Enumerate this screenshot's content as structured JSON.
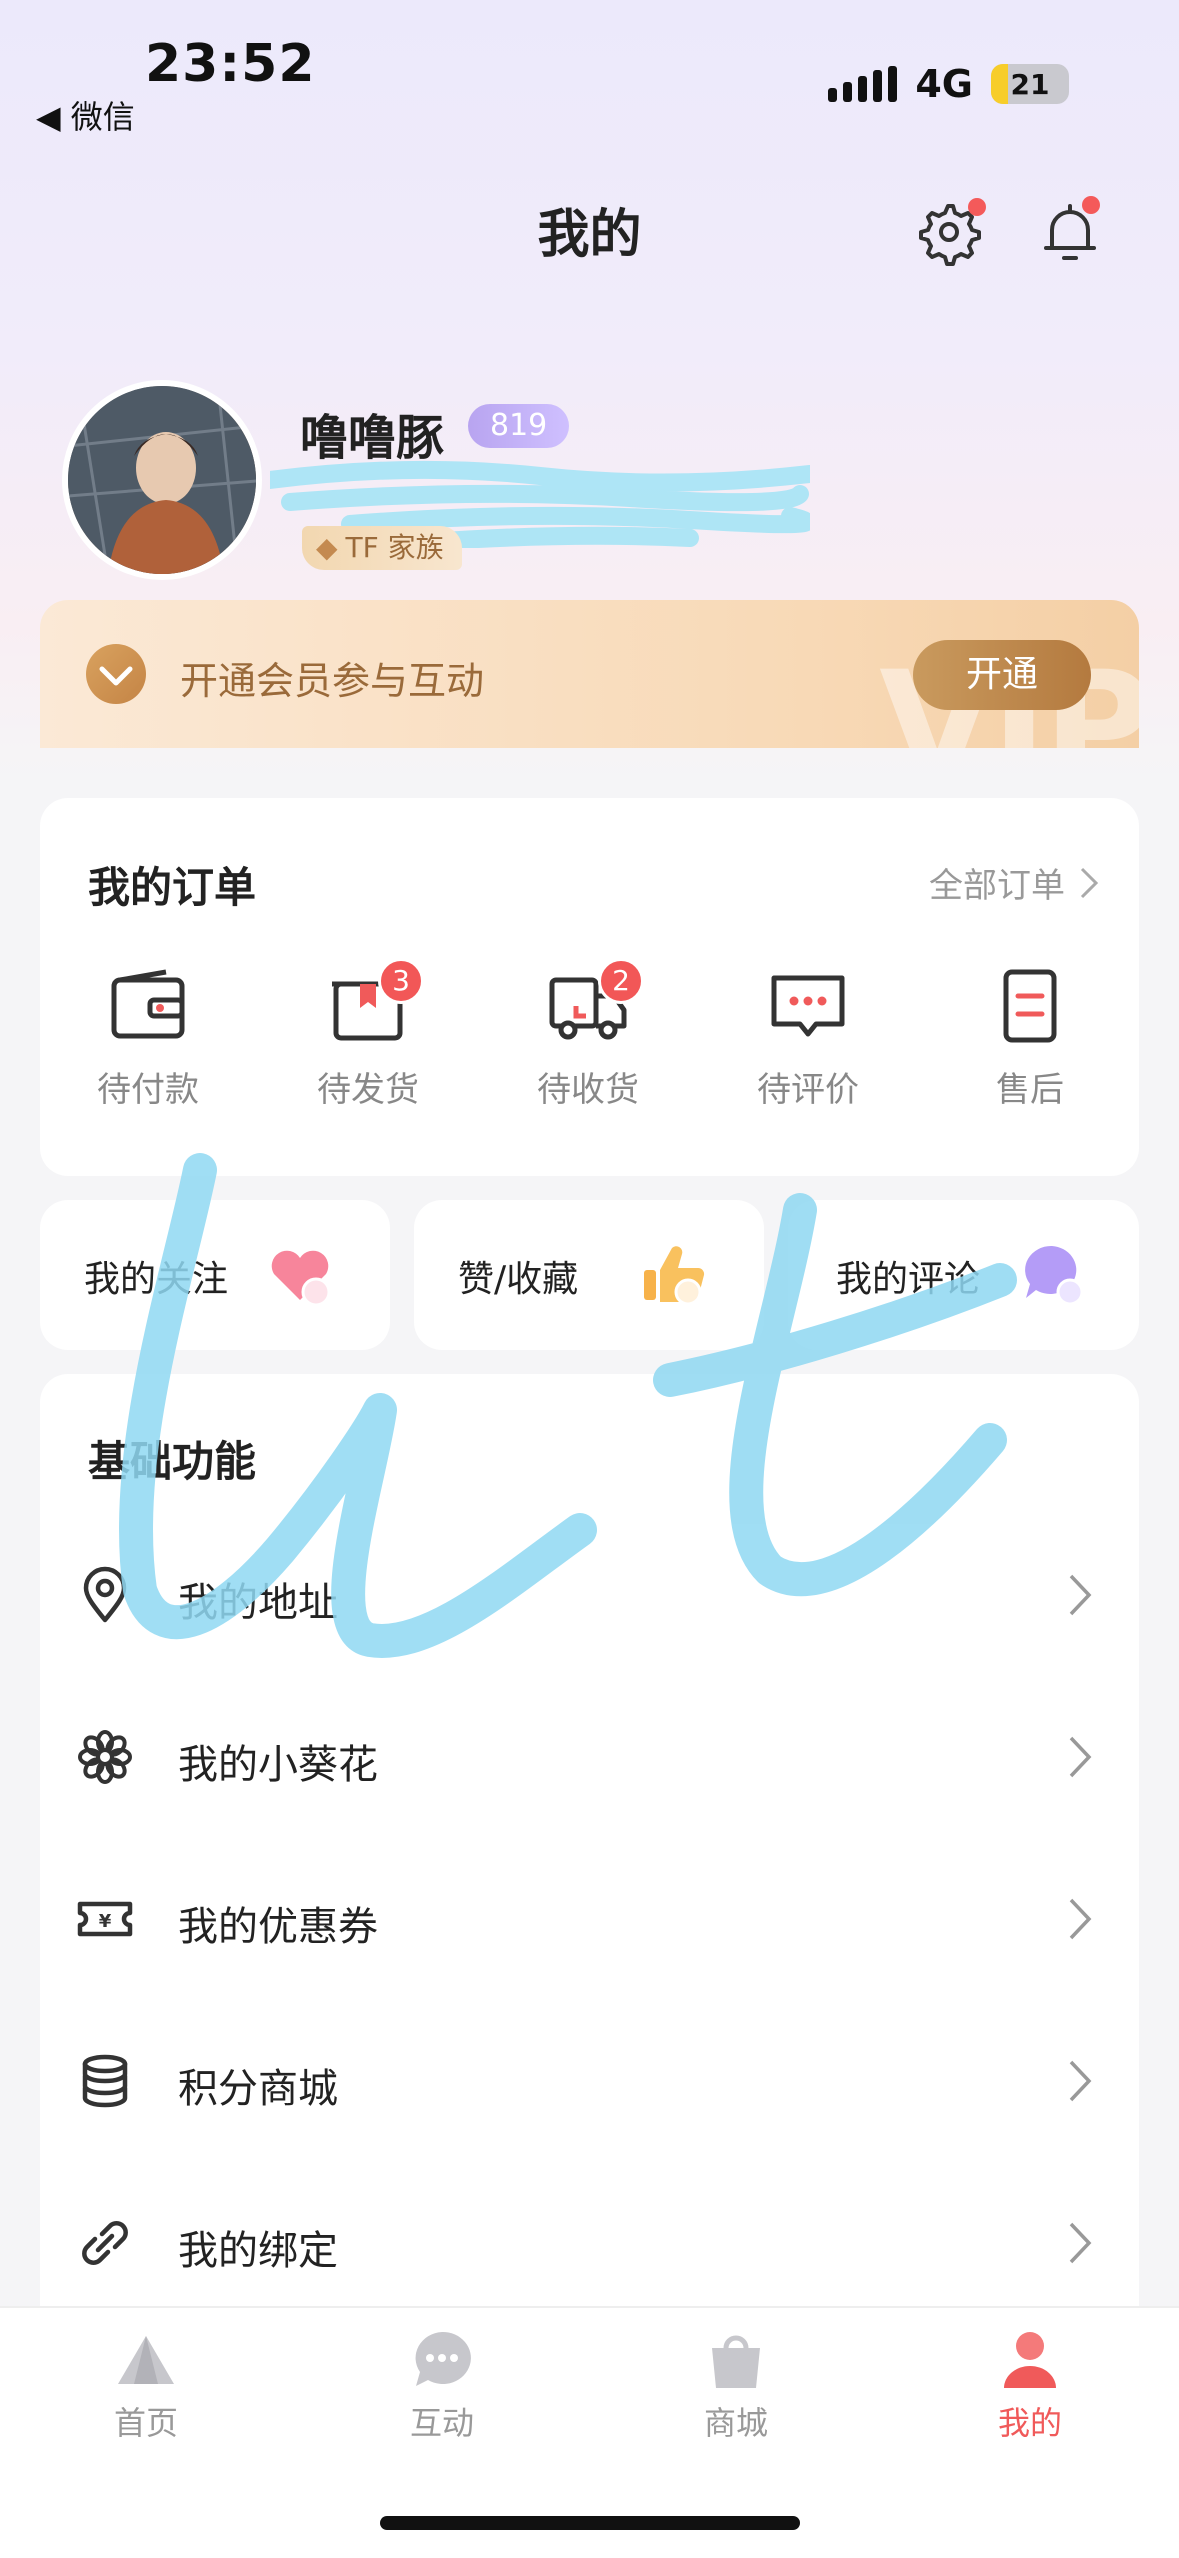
{
  "status_bar": {
    "time": "23:52",
    "back_app": "◀ 微信",
    "network": "4G",
    "battery": "21"
  },
  "header": {
    "title": "我的"
  },
  "profile": {
    "name": "噜噜豚",
    "uid_badge": "819",
    "tag": "TF 家族"
  },
  "vip": {
    "text": "开通会员参与互动",
    "button": "开通",
    "watermark": "VIP"
  },
  "orders": {
    "title": "我的订单",
    "all_orders": "全部订单",
    "items": [
      {
        "label": "待付款",
        "icon": "wallet-icon",
        "badge": null
      },
      {
        "label": "待发货",
        "icon": "package-icon",
        "badge": "3"
      },
      {
        "label": "待收货",
        "icon": "truck-icon",
        "badge": "2"
      },
      {
        "label": "待评价",
        "icon": "comment-icon",
        "badge": null
      },
      {
        "label": "售后",
        "icon": "aftersale-icon",
        "badge": null
      }
    ]
  },
  "quick": [
    {
      "label": "我的关注",
      "icon": "heart-icon"
    },
    {
      "label": "赞/收藏",
      "icon": "thumbs-up-icon"
    },
    {
      "label": "我的评论",
      "icon": "chat-bubble-icon"
    }
  ],
  "basic": {
    "title": "基础功能",
    "items": [
      {
        "label": "我的地址",
        "icon": "location-pin-icon"
      },
      {
        "label": "我的小葵花",
        "icon": "flower-icon"
      },
      {
        "label": "我的优惠券",
        "icon": "coupon-icon"
      },
      {
        "label": "积分商城",
        "icon": "coins-stack-icon"
      },
      {
        "label": "我的绑定",
        "icon": "link-icon"
      }
    ]
  },
  "tabs": [
    {
      "label": "首页",
      "icon": "home-mountain-icon",
      "active": false
    },
    {
      "label": "互动",
      "icon": "chat-icon",
      "active": false
    },
    {
      "label": "商城",
      "icon": "shopping-bag-icon",
      "active": false
    },
    {
      "label": "我的",
      "icon": "person-icon",
      "active": true
    }
  ],
  "colors": {
    "accent": "#f05a5a",
    "vip_gold": "#b47a3f",
    "uid_badge": "#b8a4f0"
  }
}
